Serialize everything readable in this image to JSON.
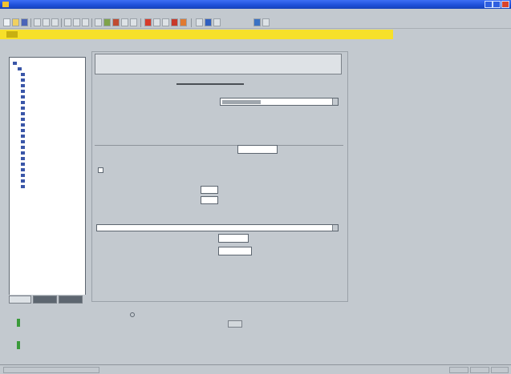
{
  "window": {
    "title": ""
  },
  "menu": {
    "items": [
      "",
      "",
      "",
      "",
      "",
      "",
      "",
      ""
    ]
  },
  "banner": {
    "text": ""
  },
  "subbar": {
    "text": ""
  },
  "sidebar": {
    "items": [
      "",
      "",
      "",
      "",
      "",
      "",
      "",
      "",
      "",
      "",
      "",
      "",
      "",
      "",
      "",
      "",
      "",
      "",
      "",
      "",
      "",
      "",
      ""
    ]
  },
  "warning": {
    "line1": "",
    "line2": ""
  },
  "panel": {
    "heading": "",
    "row1_label": "",
    "section1_title": "",
    "row2_label": "",
    "row2_unit": "",
    "row2_suffix": "",
    "checkbox_label": "",
    "sub_title": "",
    "row3_label": "",
    "row4_label": "",
    "section2_title": "",
    "row5_label": "",
    "row5_unit": "",
    "row6_label": "",
    "row6_unit": ""
  },
  "bottom": {
    "labels": [
      "",
      "",
      "",
      "",
      "",
      ""
    ],
    "values": [
      "",
      "",
      "",
      ""
    ],
    "left_items": [
      "",
      "",
      "",
      ""
    ]
  },
  "status": {
    "cells": [
      "",
      "",
      "",
      ""
    ]
  },
  "colors": {
    "banner": "#f7e02a",
    "warning_text": "#c02020",
    "titlebar": "#1d4fd8",
    "background": "#c3c9cf"
  }
}
